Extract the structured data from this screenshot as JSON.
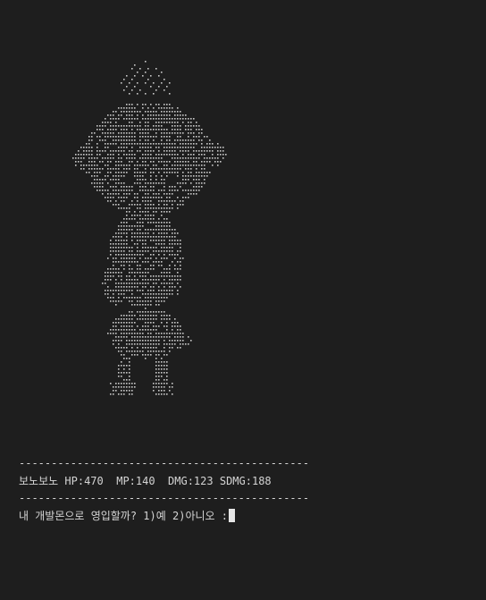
{
  "terminal": {
    "separator": "---------------------------------------------",
    "stats": {
      "name": "보노보노",
      "hp": "HP:470",
      "mp": "MP:140",
      "dmg": "DMG:123",
      "sdmg": "SDMG:188"
    },
    "prompt": "내 개발몬으로 영입할까? 1)예 2)아니오 :"
  },
  "colors": {
    "background": "#1e1e1e",
    "text": "#d4d4d4",
    "art_dots": "#c8c8c8",
    "cursor": "#e6e6e6"
  }
}
